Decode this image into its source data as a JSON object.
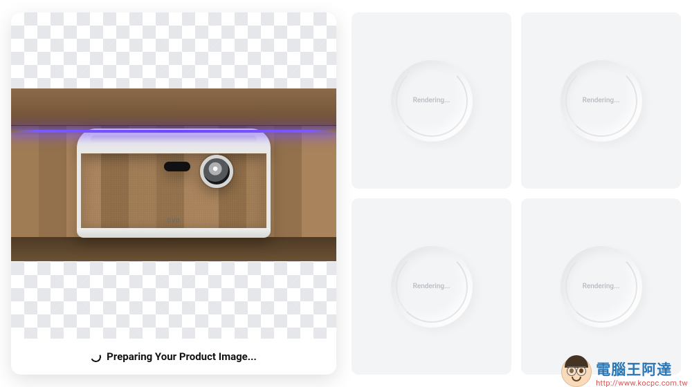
{
  "left_panel": {
    "status_text": "Preparing Your Product Image...",
    "product_brand_label": "OVO"
  },
  "slots": [
    {
      "label": "Rendering..."
    },
    {
      "label": "Rendering..."
    },
    {
      "label": "Rendering..."
    },
    {
      "label": "Rendering..."
    }
  ],
  "watermark": {
    "title": "電腦王阿達",
    "url": "http://www.kocpc.com.tw"
  }
}
